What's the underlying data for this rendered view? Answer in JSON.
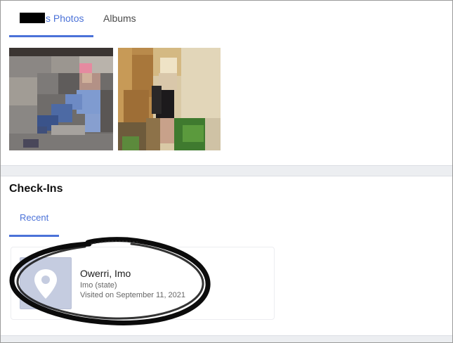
{
  "tabs": {
    "photos_label": "s Photos",
    "albums_label": "Albums"
  },
  "photos": [
    {
      "icon": "pixelated-photo"
    },
    {
      "icon": "pixelated-photo"
    }
  ],
  "checkins": {
    "title": "Check-Ins",
    "tab_recent": "Recent",
    "place": {
      "name": "Owerri, Imo",
      "sub": "Imo (state)",
      "visited": "Visited on September 11, 2021",
      "icon": "location-pin-icon"
    }
  },
  "colors": {
    "accent": "#4b72d8",
    "band": "#eceef1",
    "place_thumb": "#c5cce0"
  }
}
